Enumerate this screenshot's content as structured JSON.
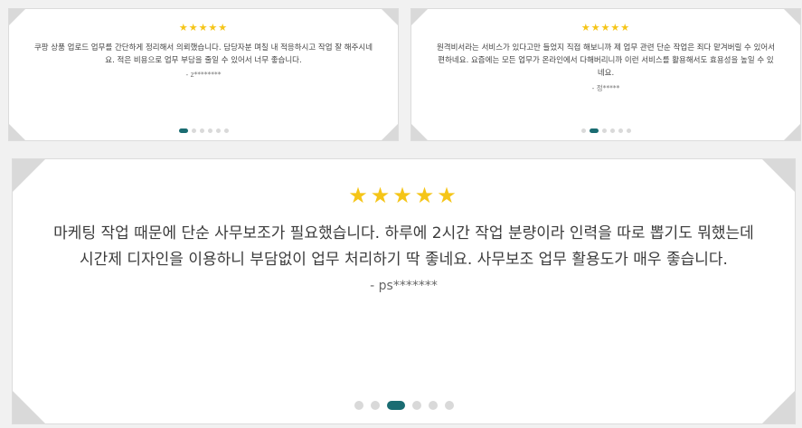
{
  "reviews": [
    {
      "stars": "★★★★★",
      "text": "쿠팡 상품 업로드 업무를 간단하게 정리해서 의뢰했습니다. 담당자분 며칠 내 적응하시고 작업 잘 해주시네요. 적은 비용으로 업무 부담을 줄일 수 있어서 너무 좋습니다.",
      "author": "- z********"
    },
    {
      "stars": "★★★★★",
      "text": "원격비서라는 서비스가 있다고만 들었지 직접 해보니까 제 업무 관련 단순 작업은 죄다 맡겨버릴 수 있어서 편하네요. 요즘에는 모든 업무가 온라인에서 다해버리니까 이런 서비스를 활용해서도 효용성을 높일 수 있네요.",
      "author": "- 정*****"
    },
    {
      "stars": "★★★★★",
      "text": "마케팅 작업 때문에 단순 사무보조가 필요했습니다. 하루에 2시간 작업 분량이라 인력을 따로 뽑기도 뭐했는데 시간제 디자인을 이용하니 부담없이 업무 처리하기 딱 좋네요. 사무보조 업무 활용도가 매우 좋습니다.",
      "author": "- ps*******"
    }
  ],
  "carousel_dots": {
    "count": 6,
    "active_card1": 1,
    "active_card2": 2,
    "active_card3": 3
  },
  "colors": {
    "star": "#f5c518",
    "active_dot": "#1a6c72",
    "inactive_dot": "#d9d9d9"
  }
}
